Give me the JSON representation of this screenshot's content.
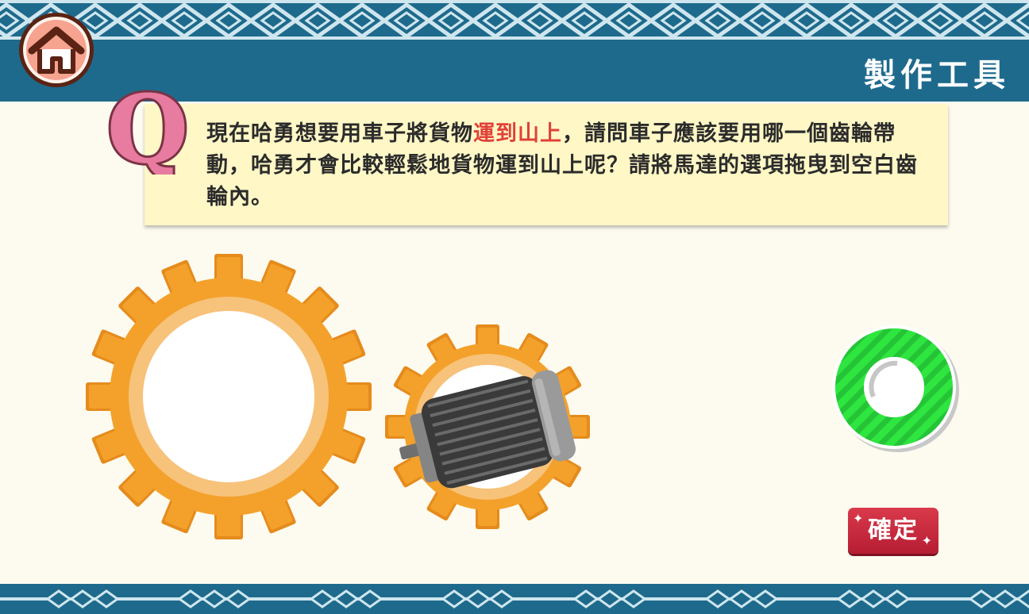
{
  "header": {
    "title": "製作工具",
    "home_icon": "home-icon"
  },
  "question": {
    "badge": "Q",
    "text_before": "現在哈勇想要用車子將貨物",
    "text_highlight": "運到山上",
    "text_after": "，請問車子應該要用哪一個齒輪帶動，哈勇才會比較輕鬆地貨物運到山上呢？請將馬達的選項拖曳到空白齒輪內。"
  },
  "gears": {
    "large_gear": "empty-gear-slot",
    "small_gear": "gear-with-motor",
    "motor": "motor-icon"
  },
  "controls": {
    "confirm_label": "確定",
    "answer_option": "green-ring-option"
  },
  "colors": {
    "banner": "#1e6a8c",
    "background": "#fdfbef",
    "question_box": "#fff7c6",
    "highlight_text": "#e0413a",
    "gear_orange": "#f3a12b",
    "option_green": "#2ee63f",
    "confirm_red": "#c62a3e",
    "q_pink": "#e87ba0"
  }
}
